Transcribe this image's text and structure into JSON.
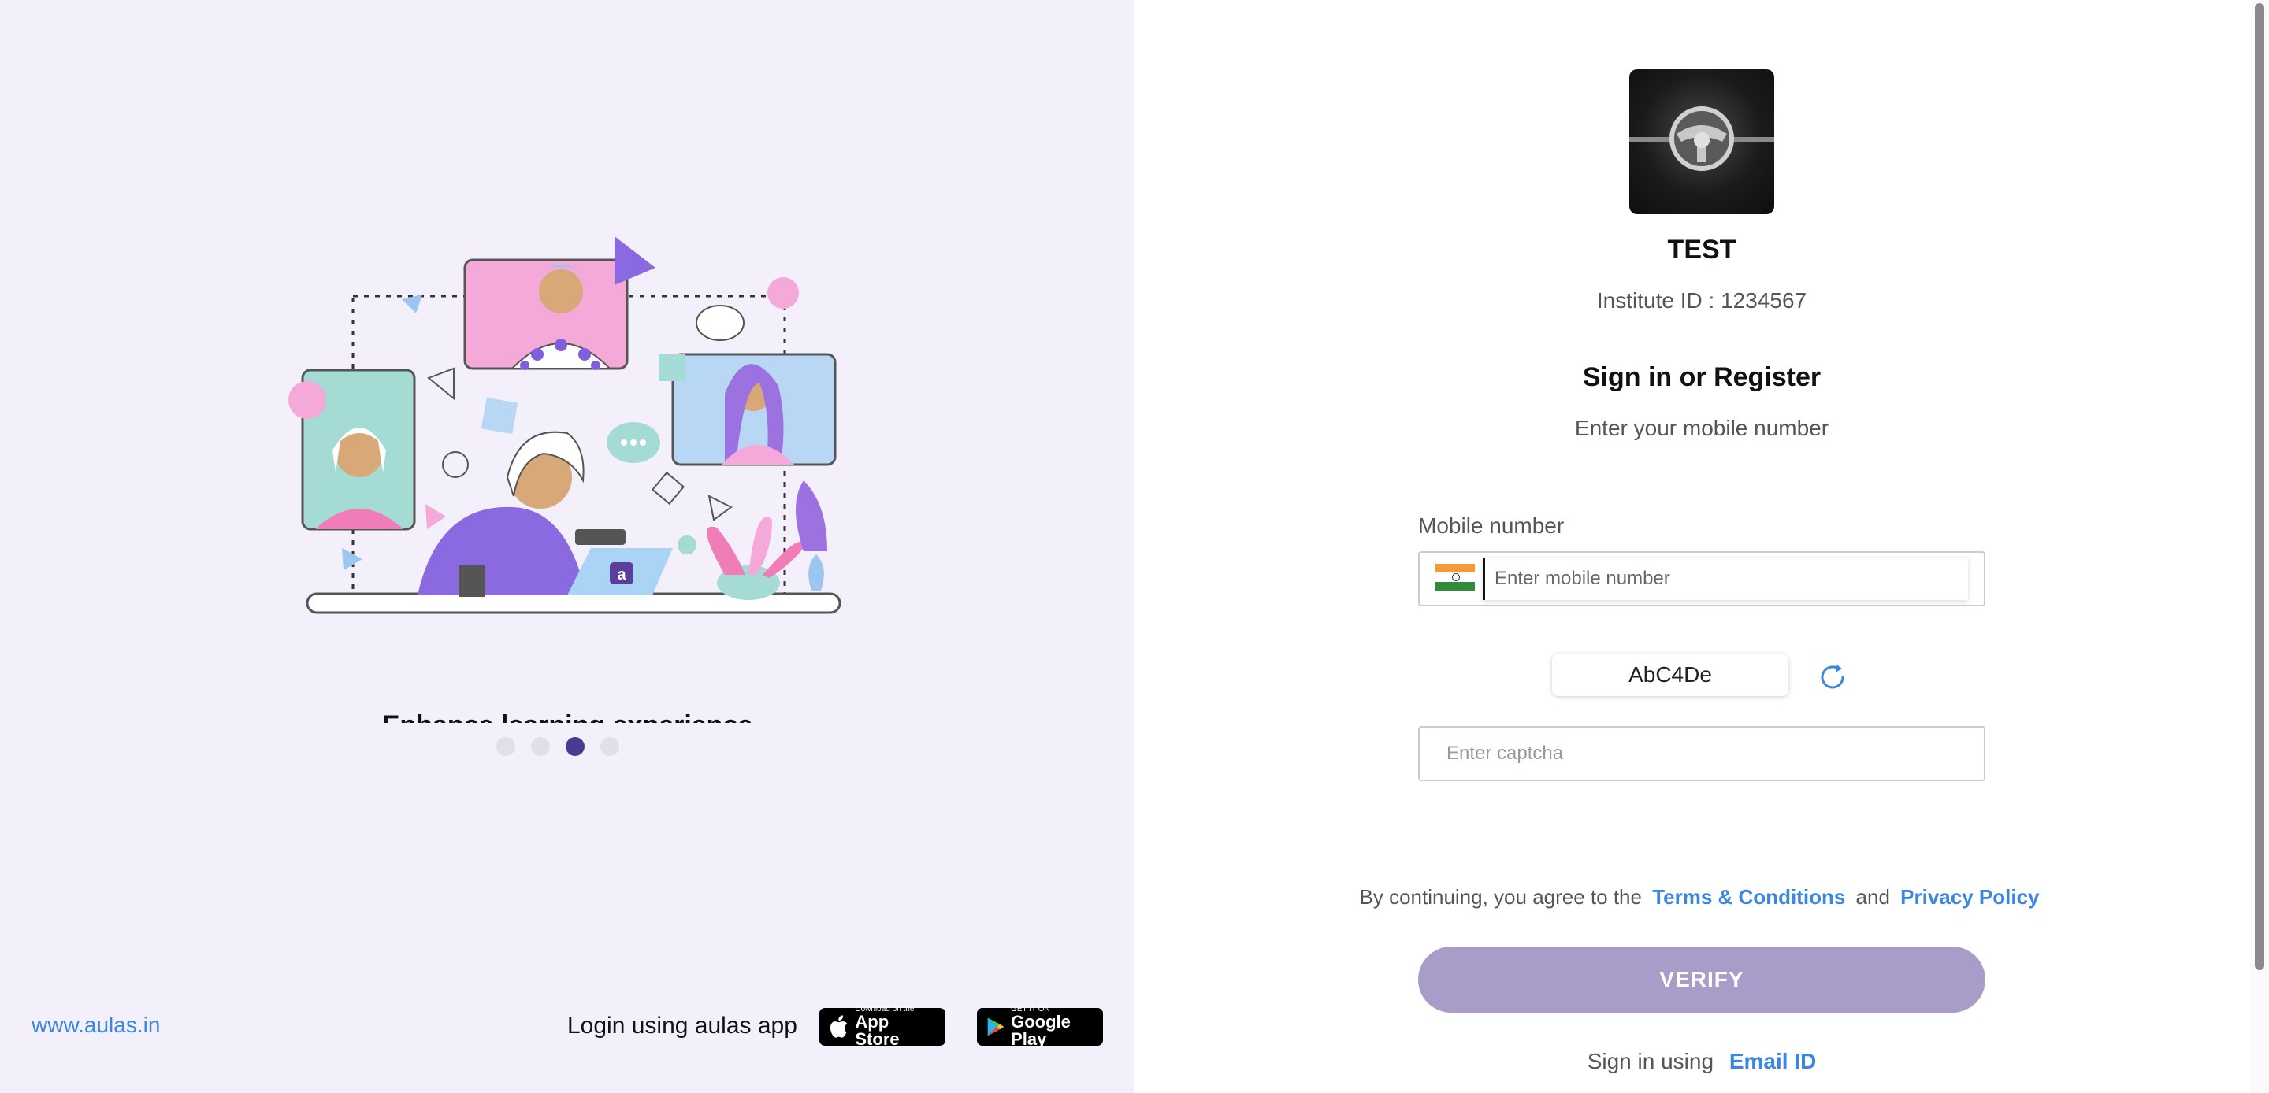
{
  "left_panel": {
    "caption": "Enhance learning experience",
    "carousel_dots": 4,
    "carousel_active_index": 2,
    "site_link": "www.aulas.in",
    "app_login_label": "Login using aulas app",
    "app_store": {
      "small": "Download on the",
      "big": "App Store"
    },
    "google_play": {
      "small": "GET IT ON",
      "big": "Google Play"
    }
  },
  "institute": {
    "name": "TEST",
    "id_label": "Institute ID : 1234567"
  },
  "signin": {
    "title": "Sign in or Register",
    "subtitle": "Enter your mobile number",
    "mobile_label": "Mobile number",
    "mobile_placeholder": "Enter mobile number",
    "captcha_text": "AbC4De",
    "captcha_placeholder": "Enter captcha",
    "terms_prefix": "By continuing, you agree to the",
    "terms_link": "Terms & Conditions",
    "terms_and": "and",
    "privacy_link": "Privacy Policy",
    "verify_label": "VERIFY",
    "alt_prefix": "Sign in using",
    "alt_link": "Email ID"
  },
  "colors": {
    "left_bg": "#f3f0fc",
    "accent_link": "#3b86e0",
    "verify_bg": "#a99cc9",
    "dot_active": "#4a3a92"
  }
}
